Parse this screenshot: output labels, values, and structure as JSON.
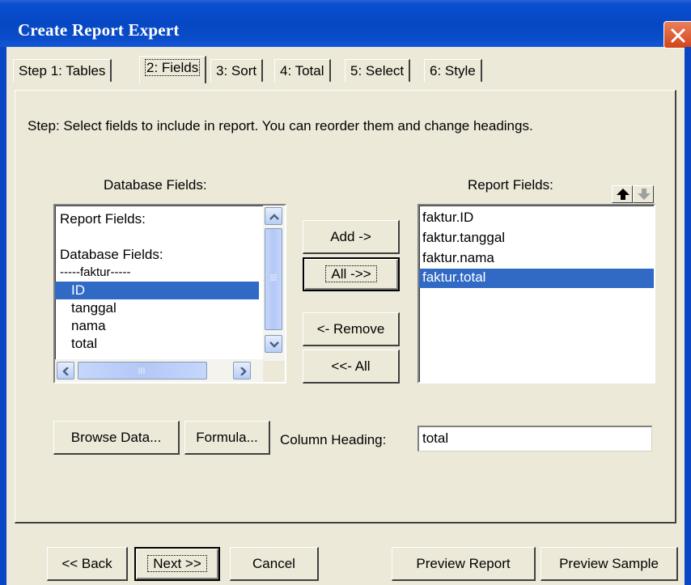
{
  "window": {
    "title": "Create Report Expert"
  },
  "tabs": [
    {
      "label": "Step 1: Tables",
      "active": false
    },
    {
      "label": "2: Fields",
      "active": true
    },
    {
      "label": "3: Sort",
      "active": false
    },
    {
      "label": "4: Total",
      "active": false
    },
    {
      "label": "5: Select",
      "active": false
    },
    {
      "label": "6: Style",
      "active": false
    }
  ],
  "instruction": "Step:  Select fields to include in report.  You can reorder them and change headings.",
  "database_fields": {
    "label": "Database Fields:",
    "items": [
      {
        "text": "Report Fields:",
        "selected": false
      },
      {
        "text": "",
        "selected": false
      },
      {
        "text": "Database Fields:",
        "selected": false
      },
      {
        "text": "-----faktur-----",
        "selected": false
      },
      {
        "text": "ID",
        "selected": true
      },
      {
        "text": "tanggal",
        "selected": false
      },
      {
        "text": "nama",
        "selected": false
      },
      {
        "text": "total",
        "selected": false
      }
    ]
  },
  "report_fields": {
    "label": "Report Fields:",
    "items": [
      {
        "text": "faktur.ID",
        "selected": false
      },
      {
        "text": "faktur.tanggal",
        "selected": false
      },
      {
        "text": "faktur.nama",
        "selected": false
      },
      {
        "text": "faktur.total",
        "selected": true
      }
    ]
  },
  "transfer_buttons": {
    "add": "Add ->",
    "add_all": "All ->>",
    "remove": "<- Remove",
    "remove_all": "<<- All"
  },
  "field_buttons": {
    "browse_data": "Browse Data...",
    "formula": "Formula..."
  },
  "column_heading": {
    "label": "Column Heading:",
    "value": "total"
  },
  "nav_buttons": {
    "back": "<< Back",
    "next": "Next >>",
    "cancel": "Cancel",
    "preview_report": "Preview Report",
    "preview_sample": "Preview Sample"
  },
  "colors": {
    "titlebar": "#0a47c4",
    "selection": "#316ac5",
    "dialog_bg": "#ece9d8",
    "close_button": "#d2441b"
  }
}
